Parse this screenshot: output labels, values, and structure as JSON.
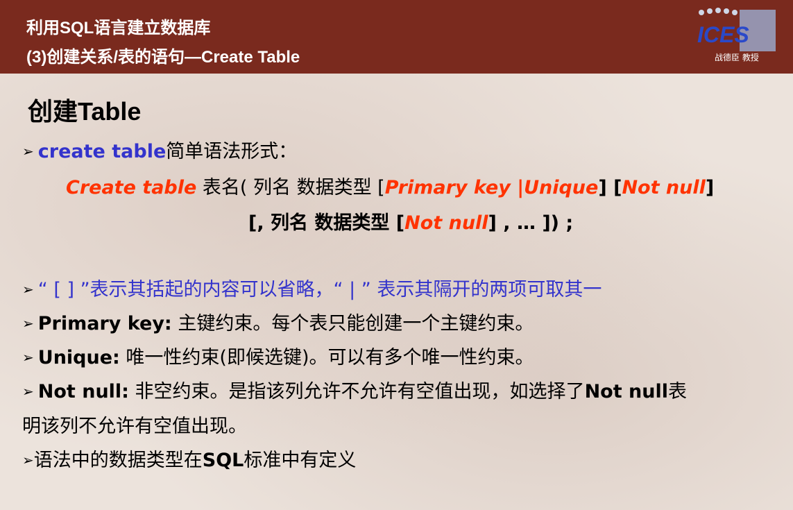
{
  "header": {
    "title_line1": "利用SQL语言建立数据库",
    "title_line2": "(3)创建关系/表的语句—Create Table",
    "logo_text": "ICES",
    "logo_caption": "战德臣 教授"
  },
  "heading": "创建Table",
  "bullet1": {
    "keyword": "create table",
    "rest": "简单语法形式："
  },
  "syntax": {
    "line1": {
      "kw": "Create  table",
      "t1": "  表名( 列名  数据类型  [",
      "pk": "Primary key |Unique",
      "t2": "] [",
      "nn": "Not null",
      "t3": "]"
    },
    "line2": {
      "t1": "[, 列名  数据类型  [",
      "nn": "Not null",
      "t2": "] , … ]) ;"
    }
  },
  "bullet2": "“ [ ] ”表示其括起的内容可以省略，“ | ” 表示其隔开的两项可取其一",
  "bullet3": {
    "term": "Primary key:",
    "desc": " 主键约束。每个表只能创建一个主键约束。"
  },
  "bullet4": {
    "term": "Unique:",
    "desc": " 唯一性约束(即候选键)。可以有多个唯一性约束。"
  },
  "bullet5": {
    "term": "Not null:",
    "desc1": " 非空约束。是指该列允许不允许有空值出现，如选择了",
    "term2": "Not null",
    "desc2": "表",
    "line2": "明该列不允许有空值出现。"
  },
  "bullet6": {
    "t1": "语法中的数据类型在",
    "sql": "SQL",
    "t2": "标准中有定义"
  },
  "bullet_icon": "➢",
  "colors": {
    "header": "#7a2a1e",
    "blue": "#3333cc",
    "red": "#ff3300"
  }
}
